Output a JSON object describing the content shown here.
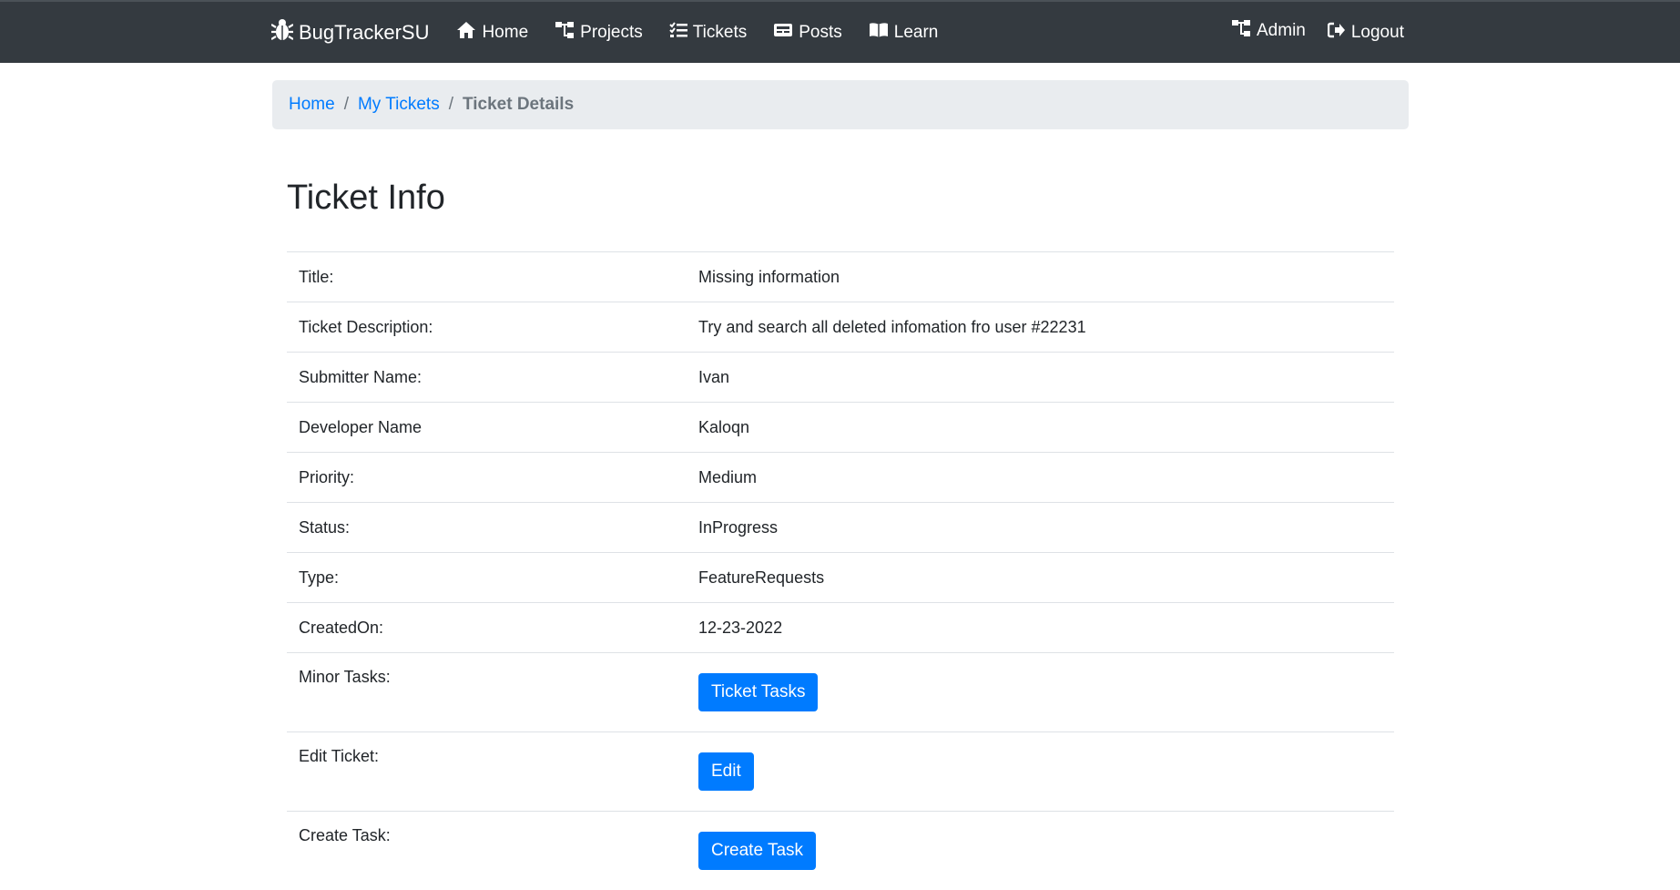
{
  "navbar": {
    "brand": "BugTrackerSU",
    "links": [
      {
        "label": "Home",
        "icon": "home-icon"
      },
      {
        "label": "Projects",
        "icon": "sitemap-icon"
      },
      {
        "label": "Tickets",
        "icon": "tasks-icon"
      },
      {
        "label": "Posts",
        "icon": "card-icon"
      },
      {
        "label": "Learn",
        "icon": "book-icon"
      }
    ],
    "right": [
      {
        "label": "Admin",
        "icon": "sitemap-icon"
      },
      {
        "label": "Logout",
        "icon": "sign-out-icon"
      }
    ],
    "background": "#343a40"
  },
  "breadcrumb": {
    "items": [
      "Home",
      "My Tickets"
    ],
    "active": "Ticket Details",
    "separator": "/"
  },
  "page": {
    "title": "Ticket Info"
  },
  "ticket": {
    "rows": [
      {
        "label": "Title:",
        "value": "Missing information"
      },
      {
        "label": "Ticket Description:",
        "value": "Try and search all deleted infomation fro user #22231"
      },
      {
        "label": "Submitter Name:",
        "value": "Ivan"
      },
      {
        "label": "Developer Name",
        "value": "Kaloqn"
      },
      {
        "label": "Priority:",
        "value": "Medium"
      },
      {
        "label": "Status:",
        "value": "InProgress"
      },
      {
        "label": "Type:",
        "value": "FeatureRequests"
      },
      {
        "label": "CreatedOn:",
        "value": "12-23-2022"
      }
    ],
    "actions": [
      {
        "label": "Minor Tasks:",
        "button": "Ticket Tasks"
      },
      {
        "label": "Edit Ticket:",
        "button": "Edit"
      },
      {
        "label": "Create Task:",
        "button": "Create Task"
      }
    ]
  },
  "colors": {
    "accent": "#007bff",
    "breadcrumb_bg": "#e9ecef"
  }
}
